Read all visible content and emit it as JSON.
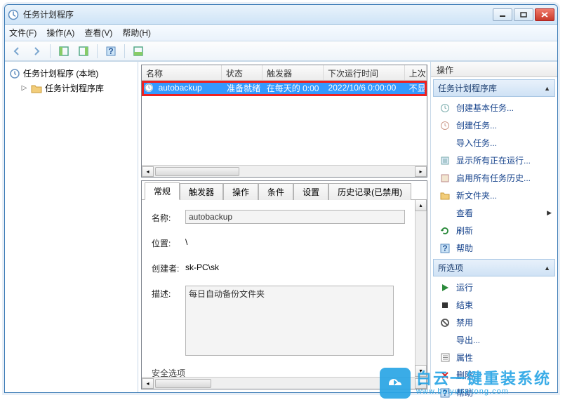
{
  "window": {
    "title": "任务计划程序"
  },
  "menu": {
    "file": "文件(F)",
    "action": "操作(A)",
    "view": "查看(V)",
    "help": "帮助(H)"
  },
  "tree": {
    "root": "任务计划程序 (本地)",
    "child": "任务计划程序库"
  },
  "list": {
    "headers": {
      "name": "名称",
      "state": "状态",
      "trigger": "触发器",
      "next": "下次运行时间",
      "last": "上次"
    },
    "row": {
      "name": "autobackup",
      "state": "准备就绪",
      "trigger": "在每天的 0:00",
      "next": "2022/10/6 0:00:00",
      "last": "不显"
    }
  },
  "tabs": {
    "general": "常规",
    "triggers": "触发器",
    "actions": "操作",
    "conditions": "条件",
    "settings": "设置",
    "history": "历史记录(已禁用)"
  },
  "detail": {
    "name_label": "名称:",
    "name_value": "autobackup",
    "location_label": "位置:",
    "location_value": "\\",
    "author_label": "创建者:",
    "author_value": "sk-PC\\sk",
    "desc_label": "描述:",
    "desc_value": "每日自动备份文件夹",
    "security_label": "安全选项"
  },
  "actions": {
    "panel_title": "操作",
    "group1": "任务计划程序库",
    "create_basic": "创建基本任务...",
    "create_task": "创建任务...",
    "import_task": "导入任务...",
    "show_running": "显示所有正在运行...",
    "enable_history": "启用所有任务历史...",
    "new_folder": "新文件夹...",
    "view": "查看",
    "refresh": "刷新",
    "help": "帮助",
    "group2": "所选项",
    "run": "运行",
    "end": "结束",
    "disable": "禁用",
    "export": "导出...",
    "properties": "属性",
    "delete": "删除",
    "help2": "帮助"
  },
  "watermark": {
    "line1": "白云一键重装系统",
    "line2": "www.baiyunxitong.com"
  }
}
